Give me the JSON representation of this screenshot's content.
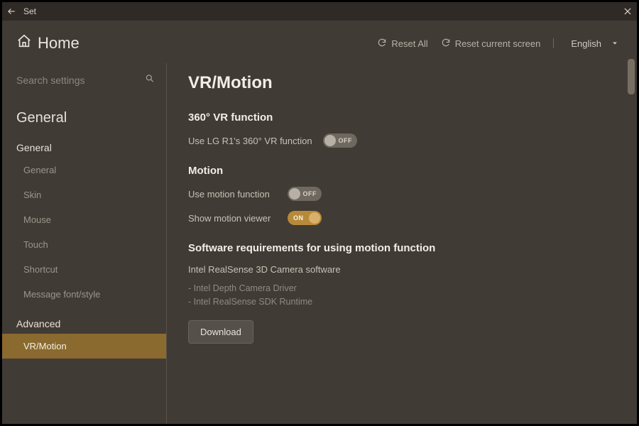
{
  "titlebar": {
    "title": "Set"
  },
  "header": {
    "home_label": "Home",
    "reset_all": "Reset All",
    "reset_current": "Reset current screen",
    "language": "English"
  },
  "search": {
    "placeholder": "Search settings"
  },
  "sidebar": {
    "section_title": "General",
    "groups": [
      {
        "header": "General",
        "items": [
          {
            "label": "General",
            "active": false
          },
          {
            "label": "Skin",
            "active": false
          },
          {
            "label": "Mouse",
            "active": false
          },
          {
            "label": "Touch",
            "active": false
          },
          {
            "label": "Shortcut",
            "active": false
          },
          {
            "label": "Message font/style",
            "active": false
          }
        ]
      },
      {
        "header": "Advanced",
        "items": [
          {
            "label": "VR/Motion",
            "active": true
          }
        ]
      }
    ]
  },
  "content": {
    "page_title": "VR/Motion",
    "sections": {
      "vr": {
        "title": "360° VR function",
        "row_label": "Use LG R1's 360° VR function",
        "row_state": "OFF"
      },
      "motion": {
        "title": "Motion",
        "use_label": "Use motion function",
        "use_state": "OFF",
        "show_label": "Show motion viewer",
        "show_state": "ON"
      },
      "req": {
        "title": "Software requirements for using motion function",
        "subtitle": "Intel RealSense 3D Camera software",
        "line1": "- Intel Depth Camera Driver",
        "line2": "- Intel RealSense SDK Runtime",
        "download": "Download"
      }
    }
  }
}
